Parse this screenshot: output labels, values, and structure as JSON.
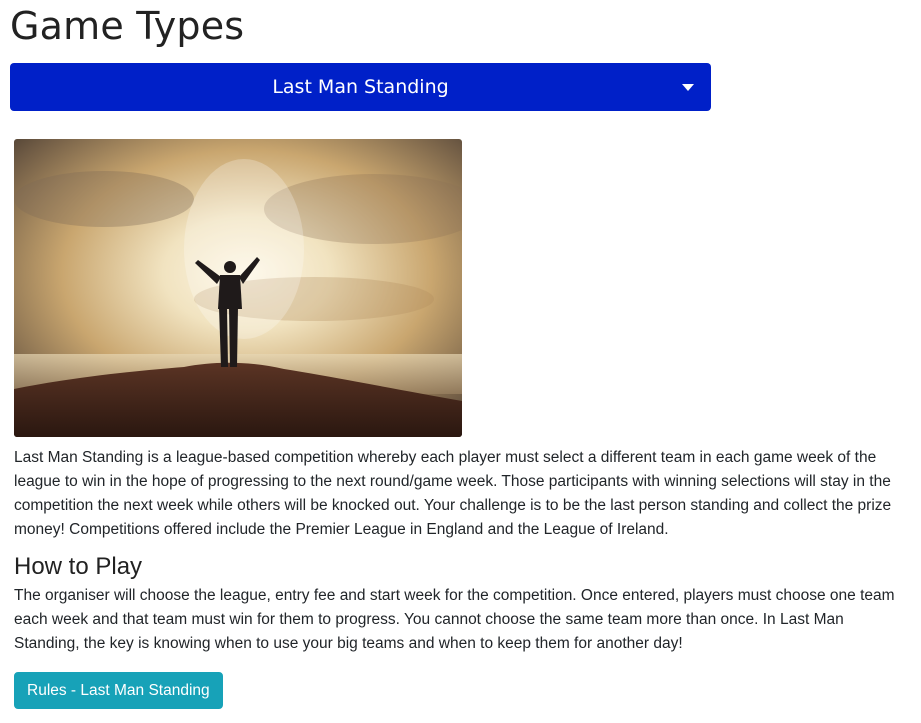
{
  "page": {
    "title": "Game Types"
  },
  "game_select": {
    "selected": "Last Man Standing",
    "icon": "chevron-down-icon"
  },
  "hero_image": {
    "alt": "Person standing on a hilltop with arms raised against a bright sky",
    "colors": {
      "sky_light": "#f3e9d2",
      "sky_warm": "#c9a46a",
      "sky_dark": "#5a4a3a",
      "ground": "#4a2a1c"
    }
  },
  "description": {
    "intro": "Last Man Standing is a league-based competition whereby each player must select a different team in each game week of the league to win in the hope of progressing to the next round/game week. Those participants with winning selections will stay in the competition the next week while others will be knocked out. Your challenge is to be the last person standing and collect the prize money! Competitions offered include the Premier League in England and the League of Ireland.",
    "how_to_play_heading": "How to Play",
    "how_to_play_text": "The organiser will choose the league, entry fee and start week for the competition. Once entered, players must choose one team each week and that team must win for them to progress. You cannot choose the same team more than once. In Last Man Standing, the key is knowing when to use your big teams and when to keep them for another day!"
  },
  "rules_button": {
    "label": "Rules - Last Man Standing"
  },
  "colors": {
    "select_bg": "#0020c8",
    "button_bg": "#17a2b8",
    "text": "#212529"
  }
}
